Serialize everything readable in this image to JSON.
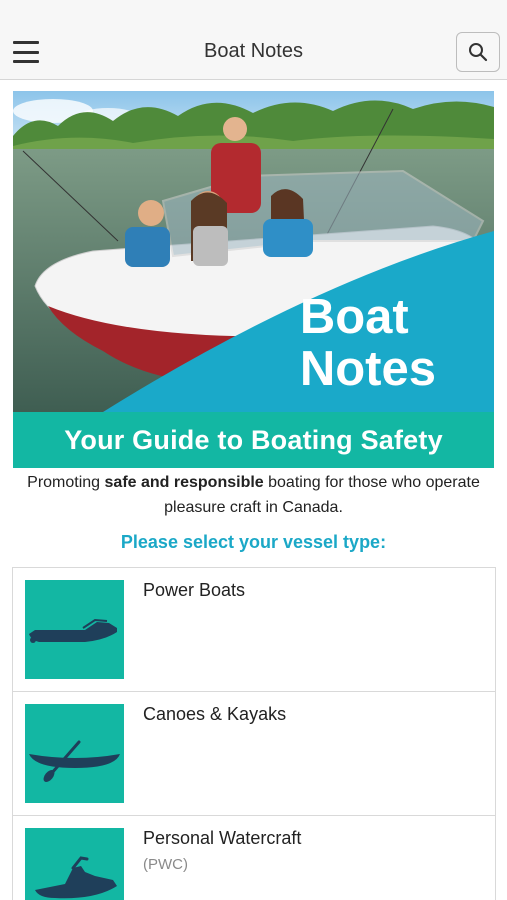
{
  "header": {
    "title": "Boat Notes",
    "menu_icon": "hamburger-menu-icon",
    "search_icon": "search-icon"
  },
  "hero": {
    "title_line1": "Boat",
    "title_line2": "Notes",
    "banner": "Your Guide to Boating Safety"
  },
  "intro": {
    "part1": "Promoting ",
    "bold": "safe and responsible",
    "part2": " boating for those who operate pleasure craft in Canada."
  },
  "select_heading": "Please select your vessel type:",
  "vessels": [
    {
      "name": "Power Boats",
      "subtitle": "",
      "icon": "power-boat-icon"
    },
    {
      "name": "Canoes & Kayaks",
      "subtitle": "",
      "icon": "canoe-icon"
    },
    {
      "name": "Personal Watercraft",
      "subtitle": "(PWC)",
      "icon": "jet-ski-icon"
    }
  ],
  "colors": {
    "accent_teal": "#13b7a3",
    "heading_blue": "#1ba8c7",
    "hero_panel_blue": "#1aa9c9"
  }
}
